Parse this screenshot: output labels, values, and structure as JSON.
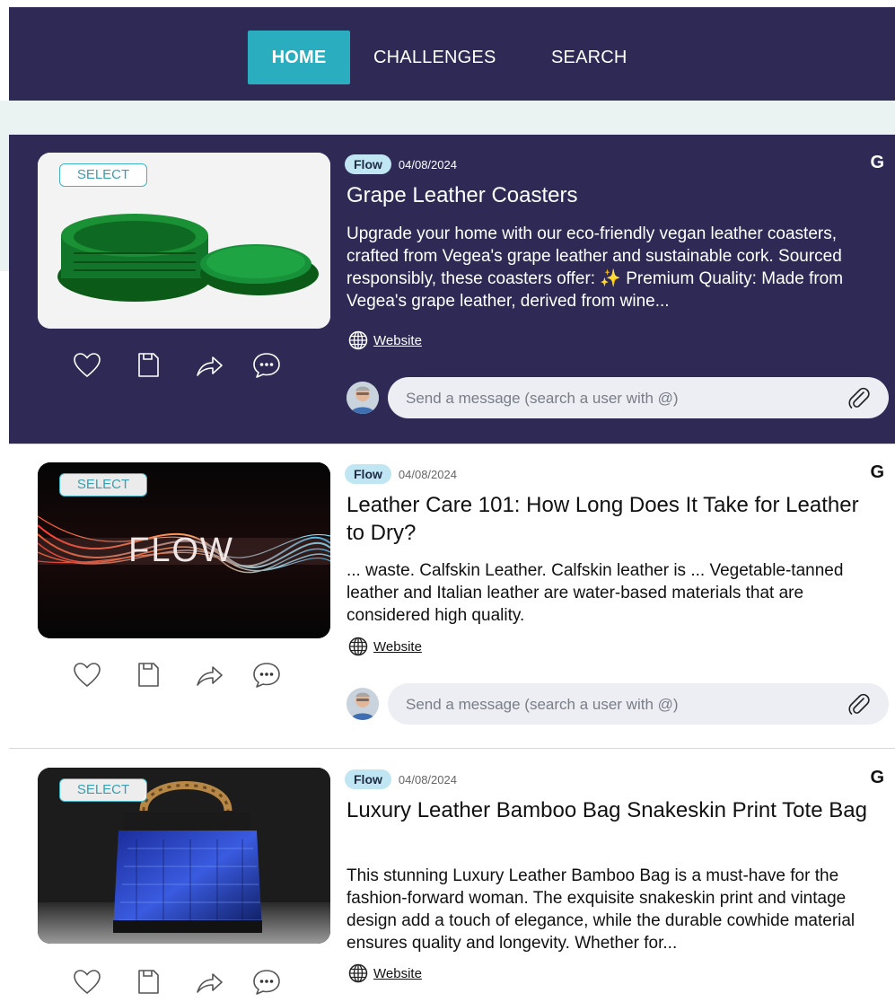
{
  "nav": {
    "home": "HOME",
    "challenges": "CHALLENGES",
    "search": "SEARCH"
  },
  "colors": {
    "nav_bg": "#2e2a55",
    "accent": "#2aaebf",
    "active_card_bg": "#2e2a55"
  },
  "cards": [
    {
      "select_label": "SELECT",
      "tag": "Flow",
      "date": "04/08/2024",
      "source_icon": "G",
      "title": "Grape Leather Coasters",
      "description": "Upgrade your home with our eco-friendly vegan leather coasters, crafted from Vegea's grape leather and sustainable cork. Sourced responsibly, these coasters offer: ✨ Premium Quality: Made from Vegea's grape leather, derived from wine...",
      "website_label": "Website",
      "message_placeholder": "Send a message (search a user with @)",
      "image": "green-coasters",
      "active": true
    },
    {
      "select_label": "SELECT",
      "tag": "Flow",
      "date": "04/08/2024",
      "source_icon": "G",
      "title": "Leather Care 101: How Long Does It Take for Leather to Dry?",
      "description": "... waste. Calfskin Leather. Calfskin leather is ... Vegetable-tanned leather and Italian leather are water-based materials that are considered high quality.",
      "website_label": "Website",
      "message_placeholder": "Send a message (search a user with @)",
      "image_text": "FLOW",
      "active": false
    },
    {
      "select_label": "SELECT",
      "tag": "Flow",
      "date": "04/08/2024",
      "source_icon": "G",
      "title": "Luxury Leather Bamboo Bag Snakeskin Print Tote Bag",
      "description": "This stunning Luxury Leather Bamboo Bag is a must-have for the fashion-forward woman. The exquisite snakeskin print and vintage design add a touch of elegance, while the durable cowhide material ensures quality and longevity. Whether for...",
      "website_label": "Website",
      "image": "snakeskin-bag",
      "active": false
    }
  ]
}
